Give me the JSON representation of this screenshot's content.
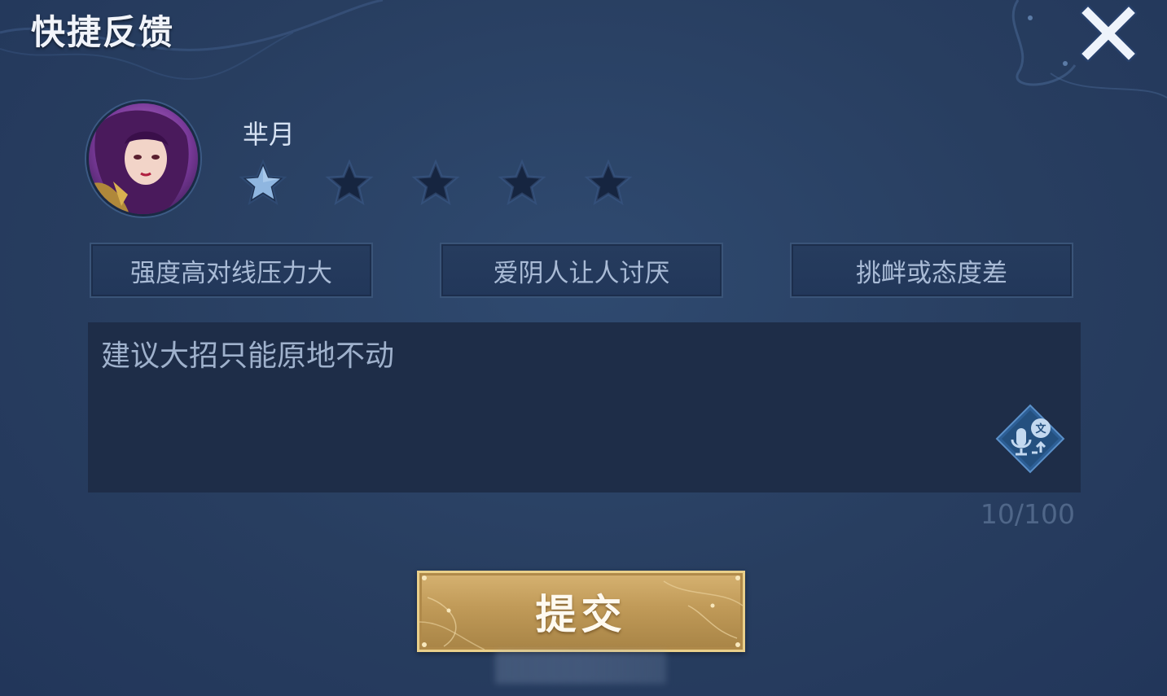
{
  "dialog": {
    "title": "快捷反馈",
    "close_icon": "close-icon"
  },
  "hero": {
    "name": "芈月",
    "avatar_icon": "hero-portrait-icon",
    "rating": 1,
    "rating_max": 5
  },
  "tags": [
    {
      "label": "强度高对线压力大"
    },
    {
      "label": "爱阴人让人讨厌"
    },
    {
      "label": "挑衅或态度差"
    }
  ],
  "feedback": {
    "text": "建议大招只能原地不动",
    "char_count": "10/100",
    "voice_icon": "voice-to-text-icon"
  },
  "submit": {
    "label": "提交"
  },
  "colors": {
    "background": "#283e60",
    "star_active": "#8fb6e0",
    "star_inactive": "#162540",
    "submit_gold": "#c9a563"
  }
}
